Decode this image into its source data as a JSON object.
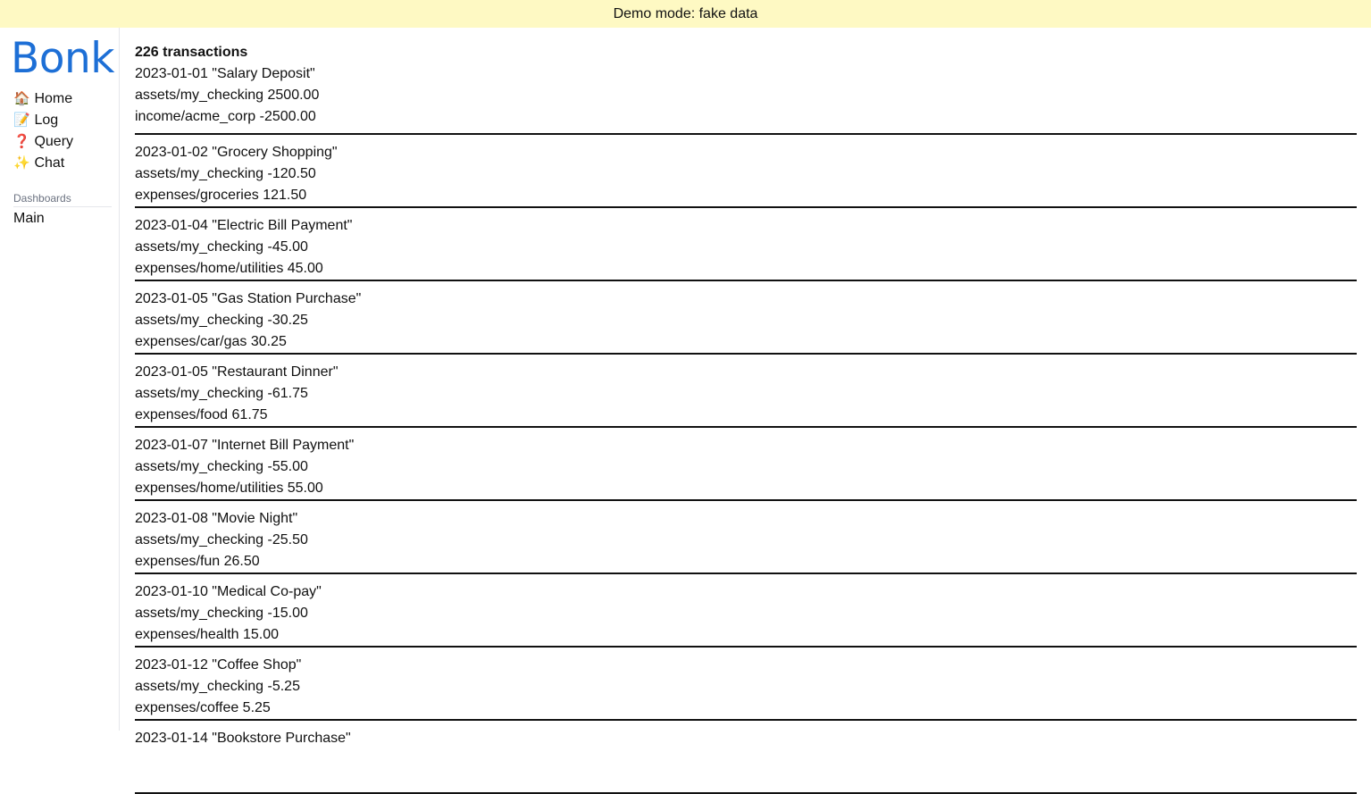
{
  "banner": {
    "text": "Demo mode: fake data"
  },
  "sidebar": {
    "logo": "Bonk",
    "nav": [
      {
        "icon": "🏠",
        "label": "Home"
      },
      {
        "icon": "📝",
        "label": "Log"
      },
      {
        "icon": "❓",
        "label": "Query"
      },
      {
        "icon": "✨",
        "label": "Chat"
      }
    ],
    "dashboards_heading": "Dashboards",
    "dashboards": [
      {
        "label": "Main"
      }
    ]
  },
  "main": {
    "count_label": "226 transactions",
    "transactions": [
      {
        "header": "2023-01-01 \"Salary Deposit\"",
        "postings": [
          "assets/my_checking 2500.00",
          "income/acme_corp -2500.00"
        ]
      },
      {
        "header": "2023-01-02 \"Grocery Shopping\"",
        "postings": [
          "assets/my_checking -120.50",
          "expenses/groceries 121.50"
        ]
      },
      {
        "header": "2023-01-04 \"Electric Bill Payment\"",
        "postings": [
          "assets/my_checking -45.00",
          "expenses/home/utilities 45.00"
        ]
      },
      {
        "header": "2023-01-05 \"Gas Station Purchase\"",
        "postings": [
          "assets/my_checking -30.25",
          "expenses/car/gas 30.25"
        ]
      },
      {
        "header": "2023-01-05 \"Restaurant Dinner\"",
        "postings": [
          "assets/my_checking -61.75",
          "expenses/food 61.75"
        ]
      },
      {
        "header": "2023-01-07 \"Internet Bill Payment\"",
        "postings": [
          "assets/my_checking -55.00",
          "expenses/home/utilities 55.00"
        ]
      },
      {
        "header": "2023-01-08 \"Movie Night\"",
        "postings": [
          "assets/my_checking -25.50",
          "expenses/fun 26.50"
        ]
      },
      {
        "header": "2023-01-10 \"Medical Co-pay\"",
        "postings": [
          "assets/my_checking -15.00",
          "expenses/health 15.00"
        ]
      },
      {
        "header": "2023-01-12 \"Coffee Shop\"",
        "postings": [
          "assets/my_checking -5.25",
          "expenses/coffee 5.25"
        ]
      },
      {
        "header": "2023-01-14 \"Bookstore Purchase\"",
        "postings": []
      }
    ]
  }
}
